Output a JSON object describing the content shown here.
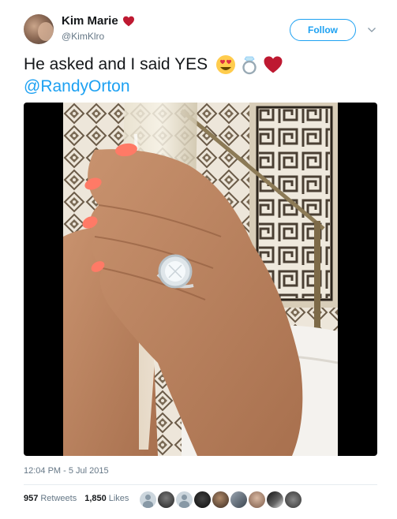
{
  "user": {
    "display_name": "Kim Marie",
    "handle": "@KimKlro",
    "name_emoji": "red-heart-icon"
  },
  "header": {
    "follow_label": "Follow",
    "menu_icon": "chevron-down-icon"
  },
  "tweet": {
    "text": "He asked and I said YES",
    "emojis": [
      "heart-eyes-emoji",
      "ring-emoji",
      "red-heart-emoji"
    ],
    "mention": "@RandyOrton"
  },
  "media": {
    "description_icon": "photo"
  },
  "meta": {
    "timestamp": "12:04 PM - 5 Jul 2015"
  },
  "stats": {
    "retweets_count": "957",
    "retweets_label": "Retweets",
    "likes_count": "1,850",
    "likes_label": "Likes"
  },
  "colors": {
    "accent": "#1da1f2",
    "secondary_text": "#657786",
    "heart": "#e0245e"
  }
}
